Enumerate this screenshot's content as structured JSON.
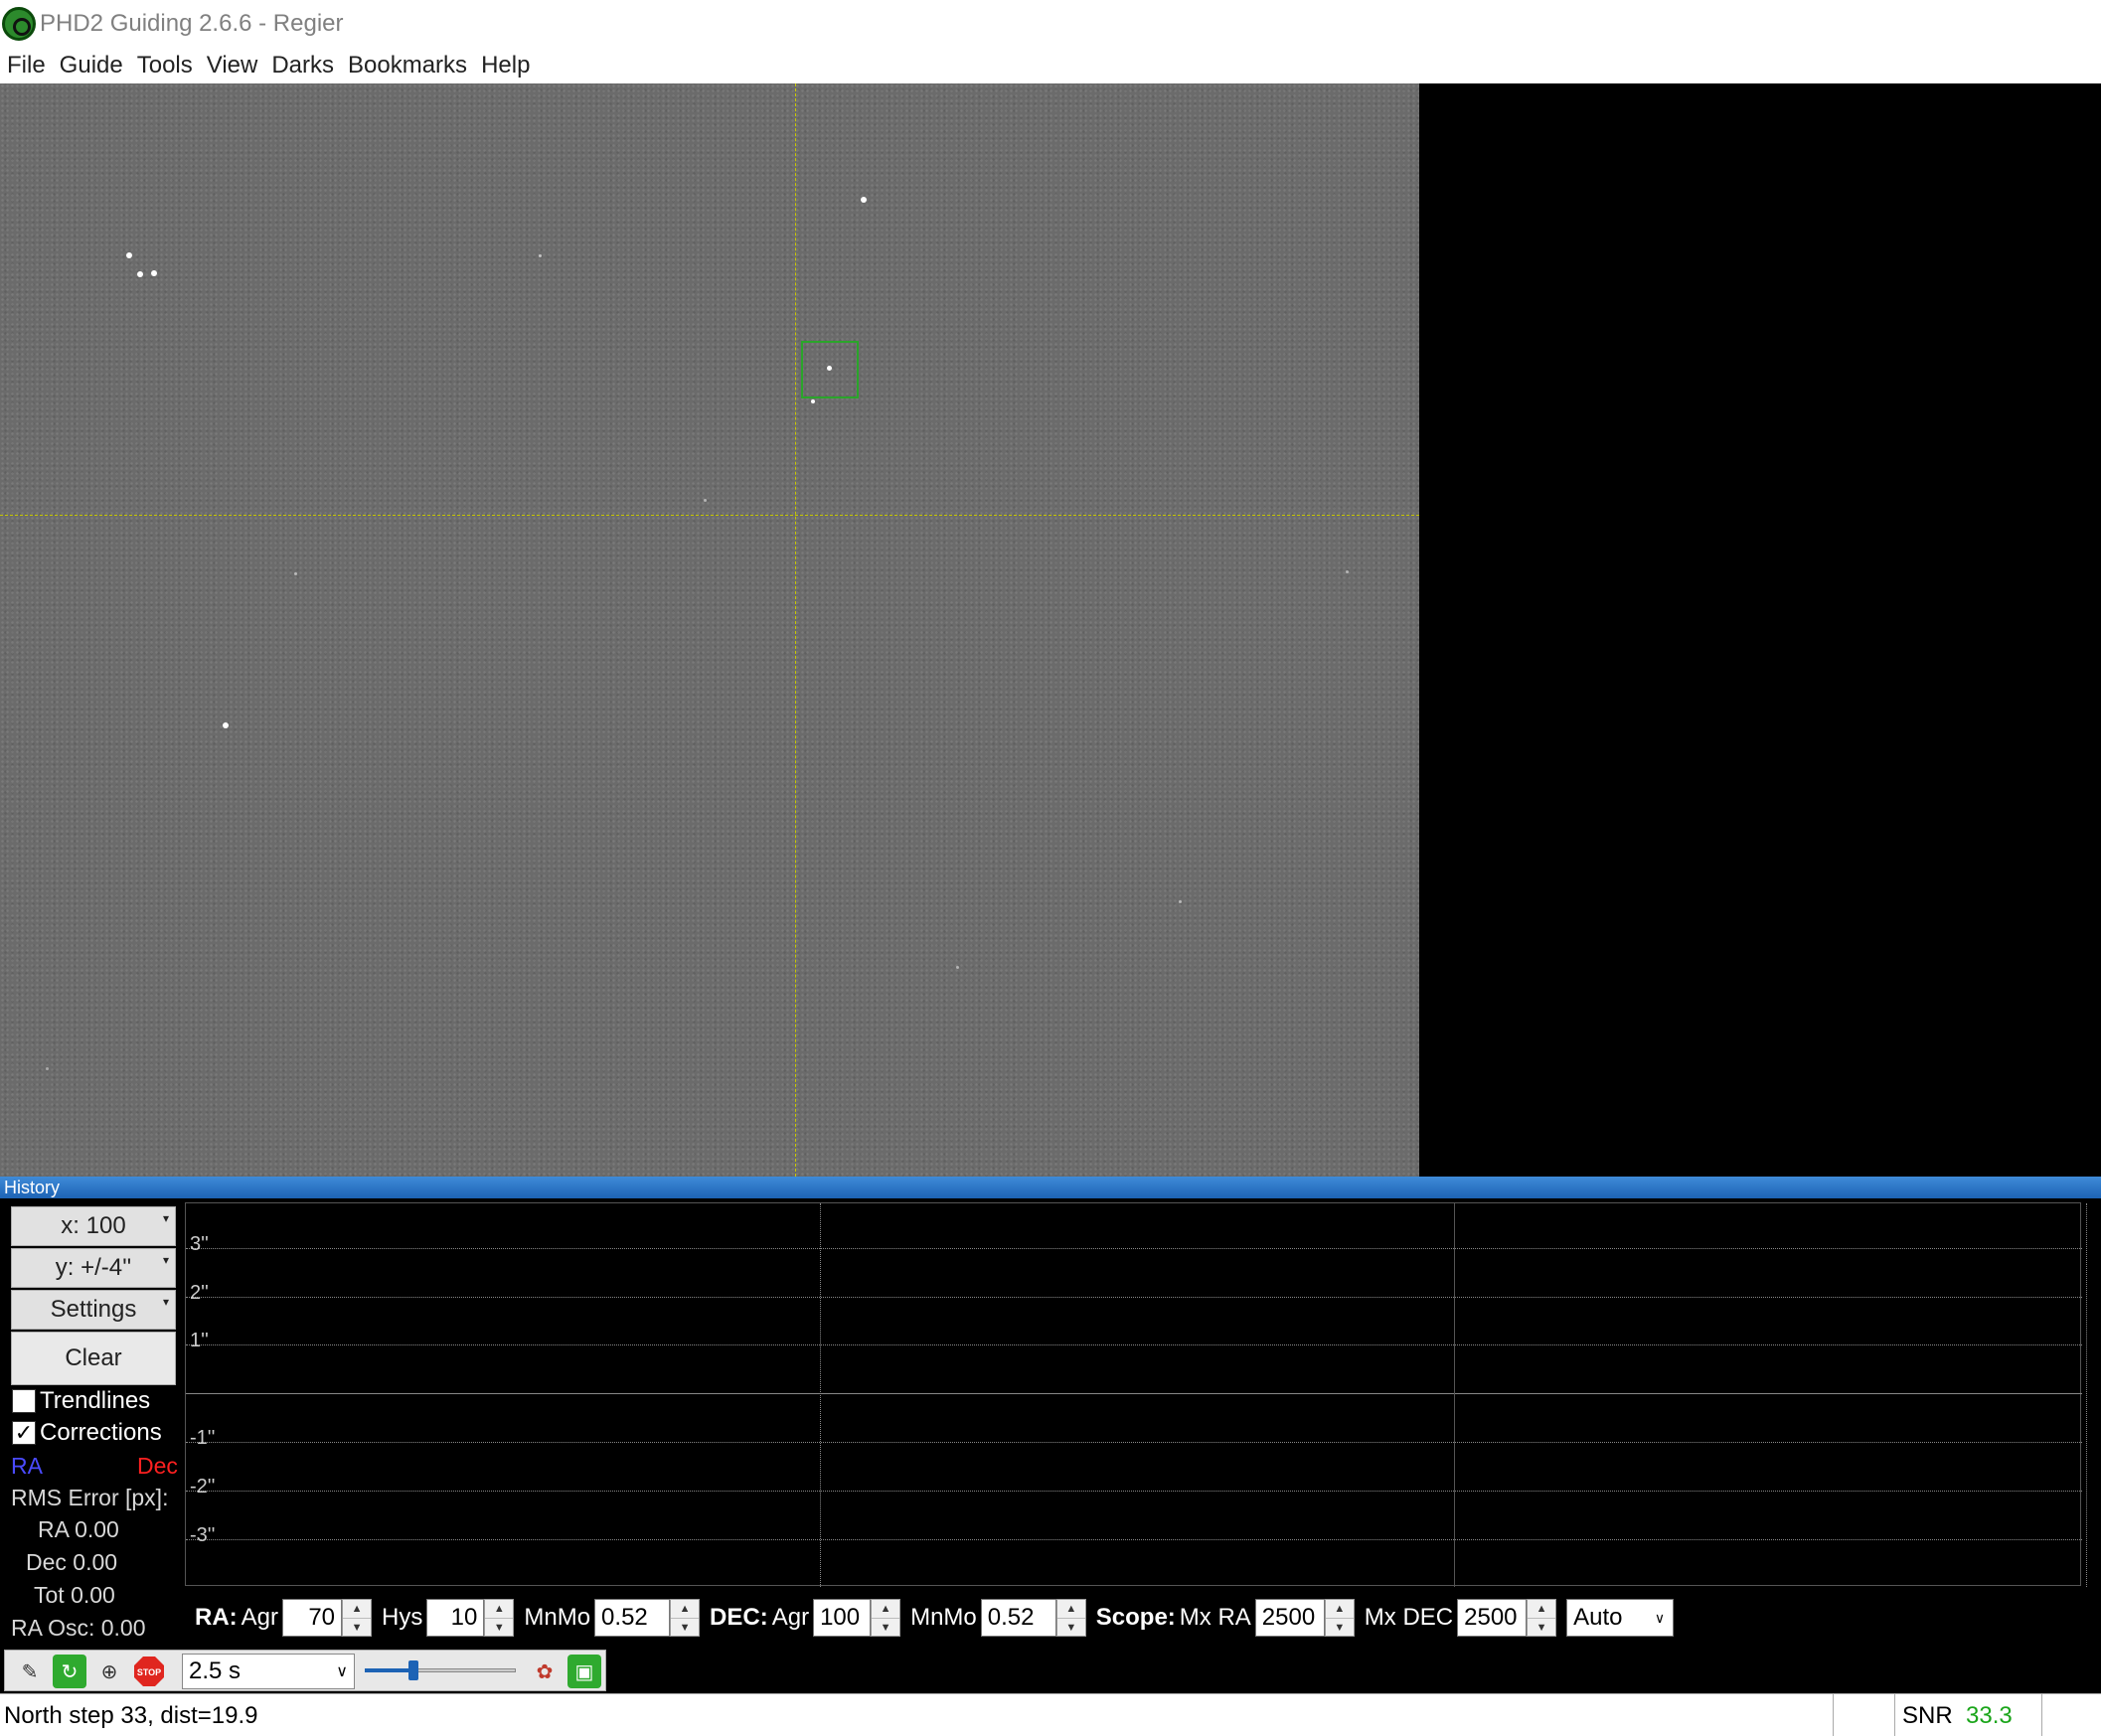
{
  "window": {
    "title": "PHD2 Guiding 2.6.6 - Regier"
  },
  "menu": [
    "File",
    "Guide",
    "Tools",
    "View",
    "Darks",
    "Bookmarks",
    "Help"
  ],
  "history": {
    "header": "History",
    "x_scale": "x: 100",
    "y_scale": "y: +/-4''",
    "settings_label": "Settings",
    "clear_label": "Clear",
    "trendlines": {
      "label": "Trendlines",
      "checked": false
    },
    "corrections": {
      "label": "Corrections",
      "checked": true
    },
    "ra_label": "RA",
    "dec_label": "Dec",
    "ra_color": "#4a4aff",
    "dec_color": "#ff2020",
    "rms_label": "RMS Error [px]:",
    "rms_ra": "RA 0.00",
    "rms_dec": "Dec 0.00",
    "rms_tot": "Tot 0.00",
    "ra_osc": "RA Osc: 0.00",
    "y_ticks": [
      "3''",
      "2''",
      "1''",
      "-1''",
      "-2''",
      "-3''"
    ]
  },
  "params": {
    "ra_title": "RA:",
    "ra_agr_label": "Agr",
    "ra_agr": "70",
    "hys_label": "Hys",
    "hys": "10",
    "ra_mnmo_label": "MnMo",
    "ra_mnmo": "0.52",
    "dec_title": "DEC:",
    "dec_agr_label": "Agr",
    "dec_agr": "100",
    "dec_mnmo_label": "MnMo",
    "dec_mnmo": "0.52",
    "scope_title": "Scope:",
    "mx_ra_label": "Mx RA",
    "mx_ra": "2500",
    "mx_dec_label": "Mx DEC",
    "mx_dec": "2500",
    "dec_mode": "Auto"
  },
  "toolbar": {
    "exposure": "2.5 s",
    "stop_label": "STOP",
    "gamma_level": 0.32,
    "icons": [
      "pencil-icon",
      "loop-icon",
      "guide-target-icon",
      "stop-icon",
      "brain-icon",
      "camera-icon"
    ]
  },
  "status": {
    "message": "North step  33, dist=19.9",
    "snr_label": "SNR",
    "snr_value": "33.3",
    "snr_color": "#1aa51a"
  }
}
